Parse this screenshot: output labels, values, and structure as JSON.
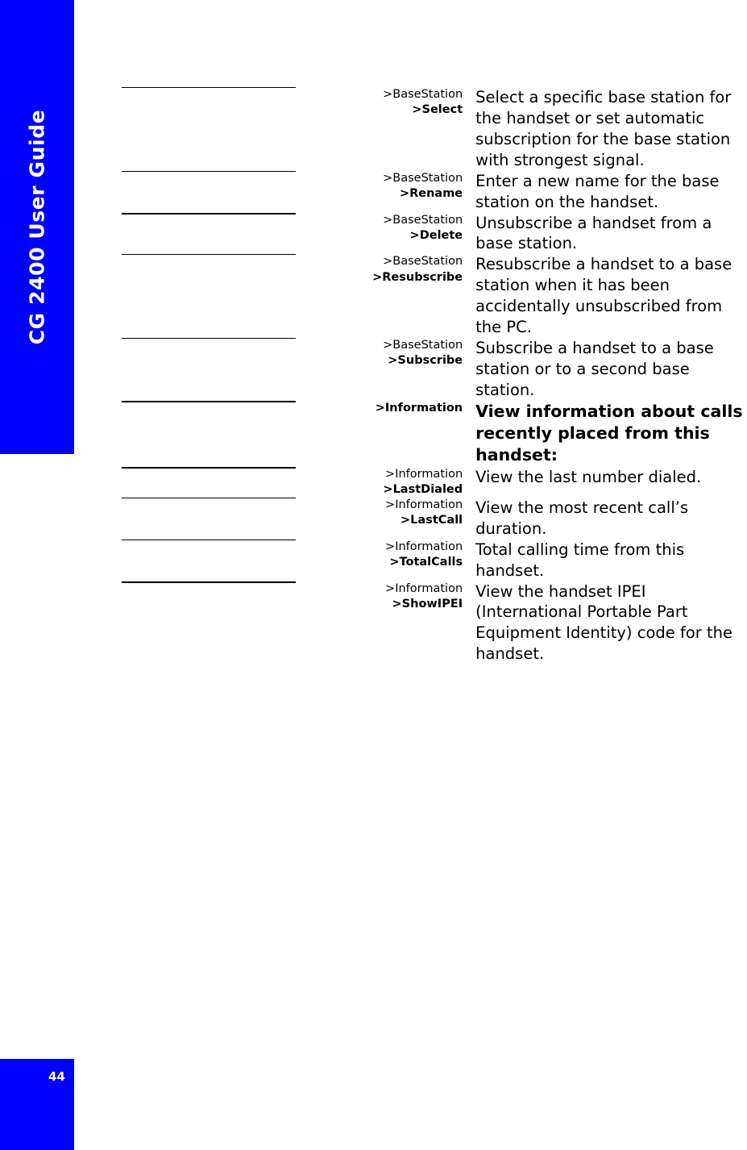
{
  "sidebar": {
    "title": "CG 2400 User Guide",
    "page_number": "44",
    "color": "#0000ff",
    "text_color": "#ffffff"
  },
  "table": {
    "rows": [
      {
        "menu_parent": ">BaseStation",
        "menu_item": ">Select",
        "description": "Select a specific base station for the handset or set automatic subscription for the base station with strongest signal.",
        "is_header": false,
        "rule_weight": "thin"
      },
      {
        "menu_parent": ">BaseStation",
        "menu_item": ">Rename",
        "description": "Enter a new name for the base station on the handset.",
        "is_header": false,
        "rule_weight": "thin"
      },
      {
        "menu_parent": ">BaseStation",
        "menu_item": ">Delete",
        "description": "Unsubscribe a handset from a base station.",
        "is_header": false,
        "rule_weight": "thick"
      },
      {
        "menu_parent": ">BaseStation",
        "menu_item": ">Resubscribe",
        "description": "Resubscribe a handset to a base station when it has been accidentally unsubscribed from the PC.",
        "is_header": false,
        "rule_weight": "thin"
      },
      {
        "menu_parent": ">BaseStation",
        "menu_item": ">Subscribe",
        "description": "Subscribe a handset to a base station or to a second base station.",
        "is_header": false,
        "rule_weight": "thin"
      },
      {
        "menu_parent": ">Information",
        "menu_item": "",
        "description": "View information about calls recently placed from this handset:",
        "is_header": true,
        "rule_weight": "thick"
      },
      {
        "menu_parent": ">Information",
        "menu_item": ">LastDialed",
        "description": "View the last number dialed.",
        "is_header": false,
        "rule_weight": "thick"
      },
      {
        "menu_parent": ">Information",
        "menu_item": ">LastCall",
        "description": "View the most recent call’s duration.",
        "is_header": false,
        "rule_weight": "thin"
      },
      {
        "menu_parent": ">Information",
        "menu_item": ">TotalCalls",
        "description": "Total calling time from this handset.",
        "is_header": false,
        "rule_weight": "thin"
      },
      {
        "menu_parent": ">Information",
        "menu_item": ">ShowIPEI",
        "description": "View the handset IPEI (International Portable Part Equipment Identity) code for the handset.",
        "is_header": false,
        "rule_weight": "thick"
      }
    ]
  }
}
